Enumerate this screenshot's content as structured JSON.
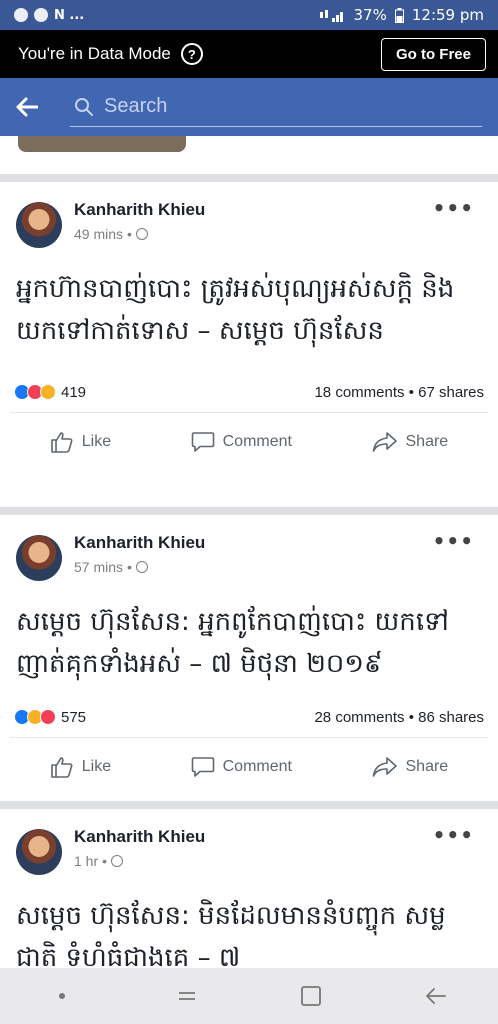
{
  "status_bar": {
    "left_text": "N ...",
    "battery": "37%",
    "time": "12:59 pm"
  },
  "data_mode": {
    "text": "You're in Data Mode",
    "help": "?",
    "button": "Go to Free"
  },
  "search": {
    "placeholder": "Search"
  },
  "posts": [
    {
      "author": "Kanharith Khieu",
      "time": "49 mins",
      "text": "អ្នកហ៊ានបាញ់បោះ ត្រូវអស់បុណ្យអស់សក្តិ និង យកទៅកាត់ទោស – សម្តេច ហ៊ុនសែន",
      "reactions": [
        "like",
        "love",
        "wow"
      ],
      "reaction_count": "419",
      "comments": "18 comments",
      "shares": "67 shares"
    },
    {
      "author": "Kanharith Khieu",
      "time": "57 mins",
      "text": "សម្តេច ហ៊ុនសែន: អ្នកពូកែបាញ់បោះ យកទៅញាត់គុកទាំងអស់ – ៧ មិថុនា ២០១៩",
      "reactions": [
        "like",
        "haha",
        "love"
      ],
      "reaction_count": "575",
      "comments": "28 comments",
      "shares": "86 shares"
    },
    {
      "author": "Kanharith Khieu",
      "time": "1 hr",
      "text": "សម្តេច ហ៊ុនសែន: មិនដែលមាននំបញ្ចុក សម្លជាតិ ទំហំធំជាងគេ – ៧"
    }
  ],
  "actions": {
    "like": "Like",
    "comment": "Comment",
    "share": "Share"
  },
  "separator": "•"
}
